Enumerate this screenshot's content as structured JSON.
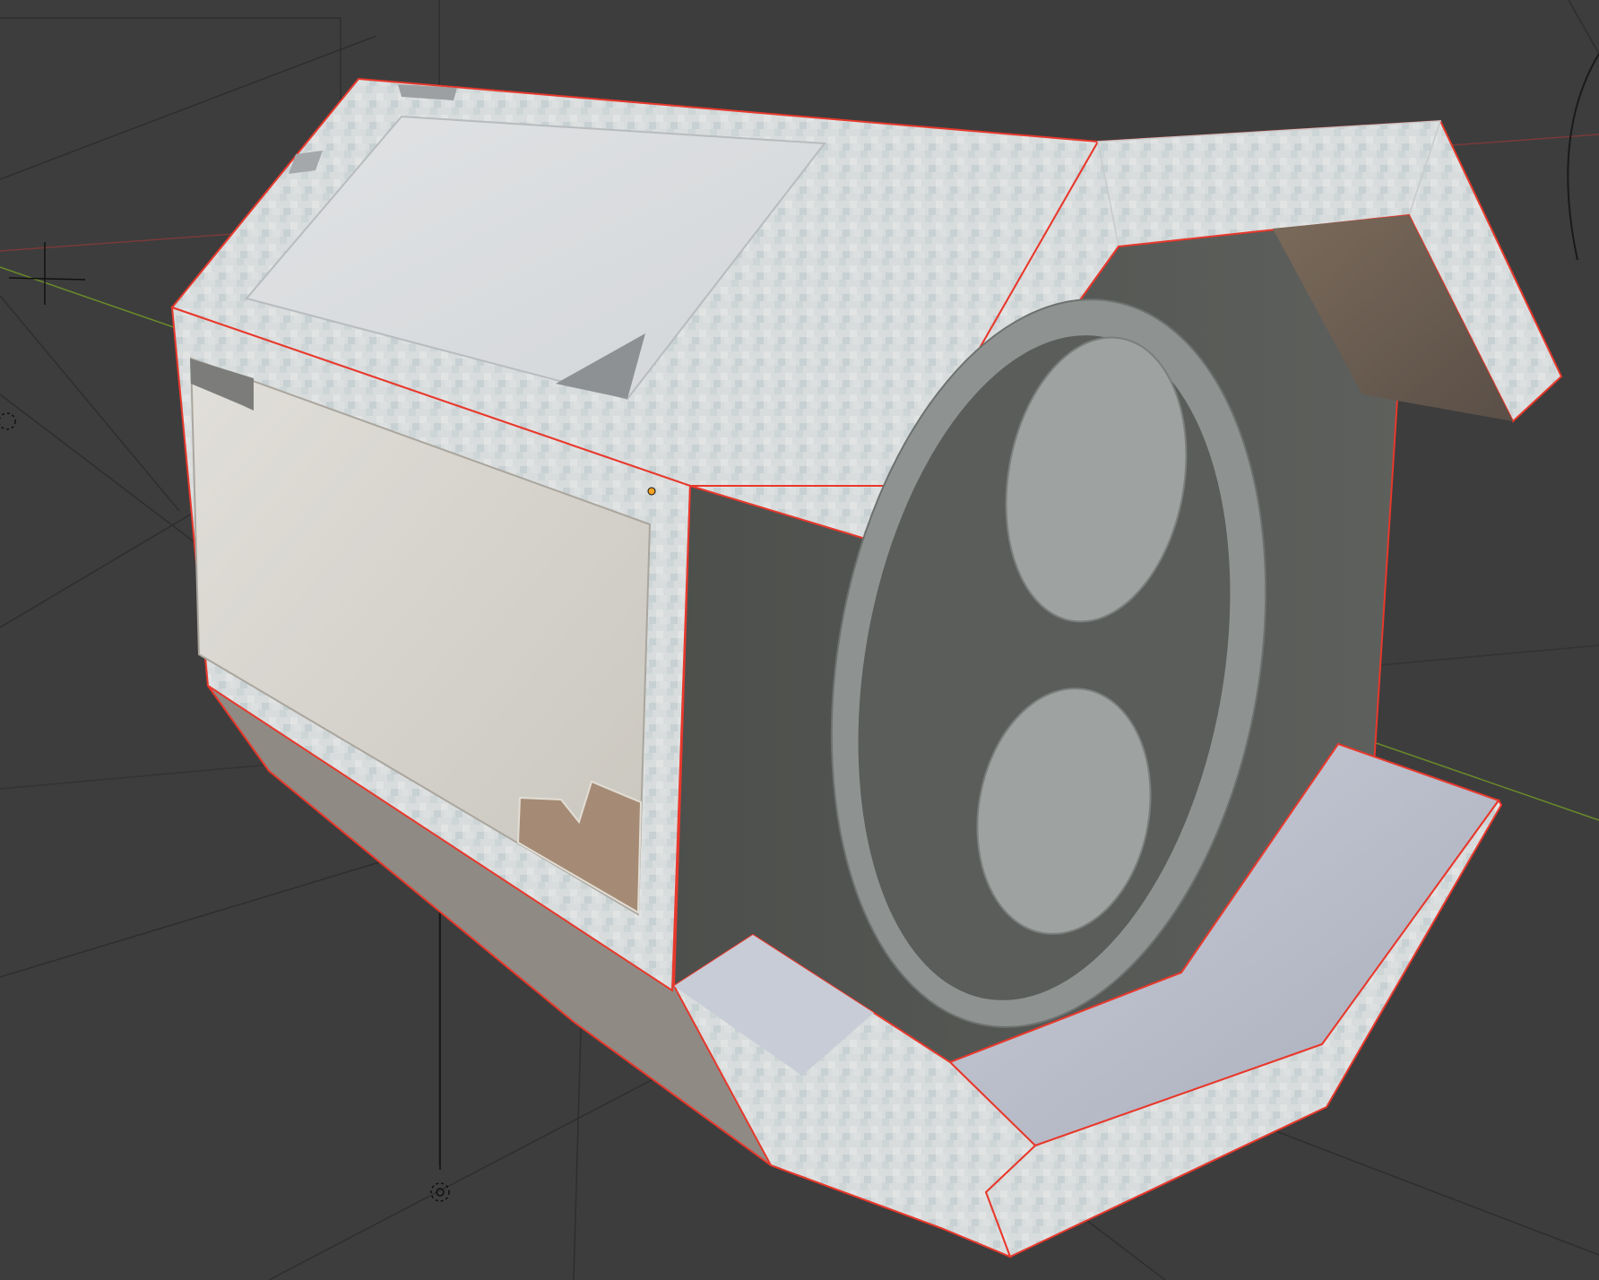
{
  "app": {
    "name": "",
    "view": "3D Viewport"
  },
  "viewport": {
    "background_color": "#3d3d3d",
    "grid_color": "#4a4a4a",
    "axis_x_color": "#7a3a3a",
    "axis_y_color": "#6b8a2a",
    "selection_outline_color": "#e8382c",
    "origin_dot_color": "#f2a324",
    "object_color_main": "#d9dcdc",
    "object_color_panel": "#cfccc4",
    "object_color_interior": "#5a5c58",
    "object_color_disc": "#8b908d",
    "object_color_accent": "#b0927a"
  },
  "icons": {
    "cursor": "3d-cursor-icon",
    "light": "light-object-icon",
    "camera": "camera-object-icon"
  }
}
